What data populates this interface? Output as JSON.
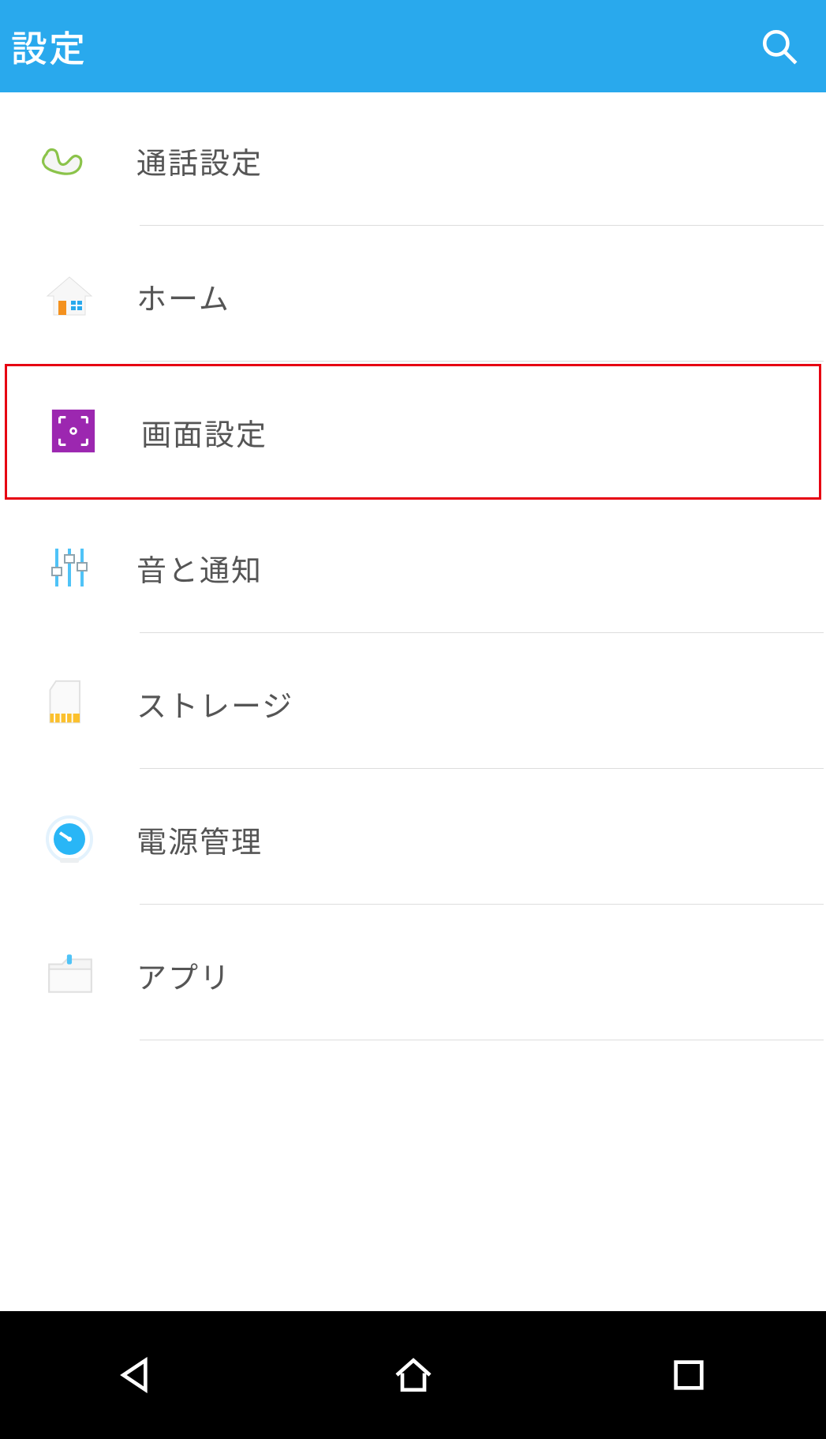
{
  "header": {
    "title": "設定",
    "search_icon": "search-icon"
  },
  "settings": {
    "items": [
      {
        "id": "call",
        "label": "通話設定",
        "icon": "phone-icon",
        "highlighted": false
      },
      {
        "id": "home",
        "label": "ホーム",
        "icon": "home-icon",
        "highlighted": false
      },
      {
        "id": "display",
        "label": "画面設定",
        "icon": "display-icon",
        "highlighted": true
      },
      {
        "id": "sound",
        "label": "音と通知",
        "icon": "sliders-icon",
        "highlighted": false
      },
      {
        "id": "storage",
        "label": "ストレージ",
        "icon": "sdcard-icon",
        "highlighted": false
      },
      {
        "id": "power",
        "label": "電源管理",
        "icon": "gauge-icon",
        "highlighted": false
      },
      {
        "id": "apps",
        "label": "アプリ",
        "icon": "folder-icon",
        "highlighted": false
      }
    ]
  },
  "navbar": {
    "back_icon": "back-icon",
    "home_icon": "nav-home-icon",
    "recent_icon": "recent-icon"
  },
  "colors": {
    "accent": "#29a9ed",
    "highlight_border": "#e60012",
    "text": "#555555",
    "divider": "#dddddd",
    "navbar_bg": "#000000"
  }
}
